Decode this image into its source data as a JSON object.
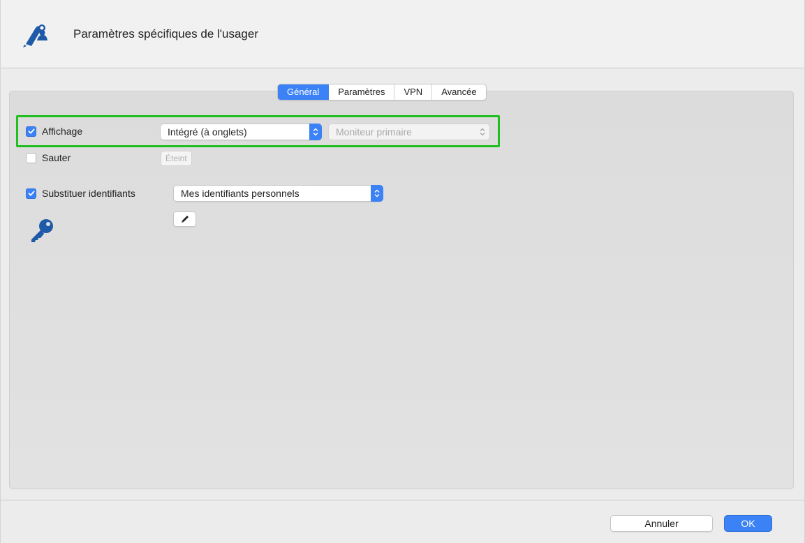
{
  "window": {
    "title": "Paramètres spécifiques de l'usager",
    "icon": "user-pen-icon"
  },
  "tabs": [
    {
      "label": "Général",
      "active": true
    },
    {
      "label": "Paramètres",
      "active": false
    },
    {
      "label": "VPN",
      "active": false
    },
    {
      "label": "Avancée",
      "active": false
    }
  ],
  "general": {
    "affichage": {
      "label": "Affichage",
      "checked": true,
      "mode_value": "Intégré (à onglets)",
      "monitor_value": "Moniteur primaire",
      "monitor_enabled": false
    },
    "sauter": {
      "label": "Sauter",
      "checked": false,
      "button_label": "Éteint",
      "button_enabled": false
    },
    "substituer": {
      "label": "Substituer identifiants",
      "checked": true,
      "value": "Mes identifiants personnels",
      "edit_icon": "pencil-icon",
      "key_icon": "key-icon"
    }
  },
  "footer": {
    "cancel_label": "Annuler",
    "ok_label": "OK"
  },
  "colors": {
    "accent": "#3a82f6",
    "highlight": "#1fbf1f",
    "icon_blue": "#1f5aa8"
  }
}
